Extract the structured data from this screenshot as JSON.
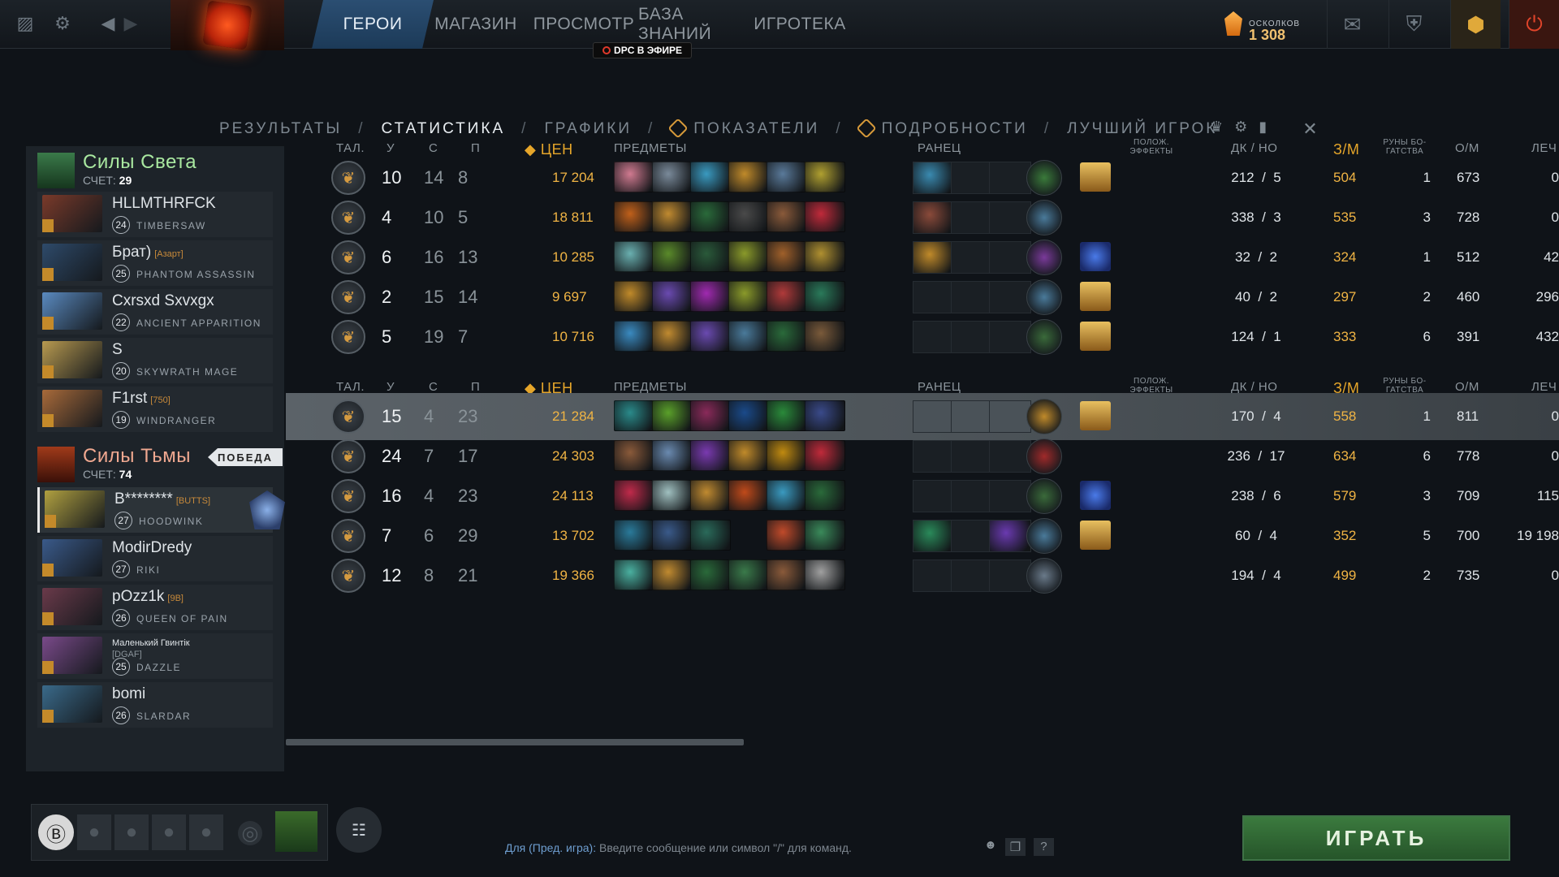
{
  "nav": {
    "tabs": [
      {
        "label": "ГЕРОИ",
        "active": true
      },
      {
        "label": "МАГАЗИН",
        "active": false
      },
      {
        "label": "ПРОСМОТР",
        "active": false
      },
      {
        "label": "БАЗА ЗНАНИЙ",
        "active": false
      },
      {
        "label": "ИГРОТЕКА",
        "active": false
      }
    ],
    "dpc_badge": "DPC В ЭФИРЕ",
    "shards": {
      "value": "1 308",
      "label": "ОСКОЛКОВ"
    }
  },
  "subtabs": [
    {
      "label": "РЕЗУЛЬТАТЫ",
      "active": false,
      "plus": false
    },
    {
      "label": "СТАТИСТИКА",
      "active": true,
      "plus": false
    },
    {
      "label": "ГРАФИКИ",
      "active": false,
      "plus": false
    },
    {
      "label": "ПОКАЗАТЕЛИ",
      "active": false,
      "plus": true
    },
    {
      "label": "ПОДРОБНОСТИ",
      "active": false,
      "plus": true
    },
    {
      "label": "ЛУЧШИЙ ИГРОК",
      "active": false,
      "plus": false
    }
  ],
  "headers": {
    "talent": "ТАЛ.",
    "kills": "У",
    "deaths": "С",
    "assists": "П",
    "networth": "ЦЕН",
    "items": "ПРЕДМЕТЫ",
    "backpack": "РАНЕЦ",
    "buffs": "ПОЛОЖ. ЭФФЕКТЫ",
    "lh_dn": "ДК / НО",
    "xpm": "З/М",
    "bounty": "РУНЫ БО-ГАТСТВА",
    "gpm": "О/М",
    "heal": "ЛЕЧ"
  },
  "radiant": {
    "name": "Силы Света",
    "score_label": "СЧЕТ:",
    "score": "29",
    "players": [
      {
        "name": "HLLMTHRFCK",
        "tag": "",
        "level": "24",
        "hero": "TIMBERSAW",
        "kills": "10",
        "deaths": "14",
        "assists": "8",
        "networth": "17 204",
        "lh": "212",
        "dn": "5",
        "xpm": "504",
        "bounty": "1",
        "gpm": "673",
        "heal": "0",
        "color": "#7a3a2a"
      },
      {
        "name": "Брат)",
        "tag": "[Азарт]",
        "level": "25",
        "hero": "PHANTOM ASSASSIN",
        "kills": "4",
        "deaths": "10",
        "assists": "5",
        "networth": "18 811",
        "lh": "338",
        "dn": "3",
        "xpm": "535",
        "bounty": "3",
        "gpm": "728",
        "heal": "0",
        "color": "#2e4a6a"
      },
      {
        "name": "Cxrsxd Sxvxgx",
        "tag": "",
        "level": "22",
        "hero": "ANCIENT APPARITION",
        "kills": "6",
        "deaths": "16",
        "assists": "13",
        "networth": "10 285",
        "lh": "32",
        "dn": "2",
        "xpm": "324",
        "bounty": "1",
        "gpm": "512",
        "heal": "42",
        "color": "#5a8ac0"
      },
      {
        "name": "S",
        "tag": "",
        "level": "20",
        "hero": "SKYWRATH MAGE",
        "kills": "2",
        "deaths": "15",
        "assists": "14",
        "networth": "9 697",
        "lh": "40",
        "dn": "2",
        "xpm": "297",
        "bounty": "2",
        "gpm": "460",
        "heal": "296",
        "color": "#b89a50"
      },
      {
        "name": "F1rst",
        "tag": "[750]",
        "level": "19",
        "hero": "WINDRANGER",
        "kills": "5",
        "deaths": "19",
        "assists": "7",
        "networth": "10 716",
        "lh": "124",
        "dn": "1",
        "xpm": "333",
        "bounty": "6",
        "gpm": "391",
        "heal": "432",
        "color": "#a86a3a"
      }
    ]
  },
  "dire": {
    "name": "Силы Тьмы",
    "victory": "ПОБЕДА",
    "score_label": "СЧЕТ:",
    "score": "74",
    "players": [
      {
        "name": "B********",
        "tag": "[BUTTS]",
        "level": "27",
        "hero": "HOODWINK",
        "kills": "15",
        "deaths": "4",
        "assists": "23",
        "networth": "21 284",
        "lh": "170",
        "dn": "4",
        "xpm": "558",
        "bounty": "1",
        "gpm": "811",
        "heal": "0",
        "color": "#b0a040"
      },
      {
        "name": "ModirDredy",
        "tag": "",
        "level": "27",
        "hero": "RIKI",
        "kills": "24",
        "deaths": "7",
        "assists": "17",
        "networth": "24 303",
        "lh": "236",
        "dn": "17",
        "xpm": "634",
        "bounty": "6",
        "gpm": "778",
        "heal": "0",
        "color": "#3a5a8a"
      },
      {
        "name": "pOzz1k",
        "tag": "[9B]",
        "level": "26",
        "hero": "QUEEN OF PAIN",
        "kills": "16",
        "deaths": "4",
        "assists": "23",
        "networth": "24 113",
        "lh": "238",
        "dn": "6",
        "xpm": "579",
        "bounty": "3",
        "gpm": "709",
        "heal": "115",
        "color": "#6a3a4a"
      },
      {
        "name": "Маленький Гвинтік",
        "tag": "",
        "tagline": "[DGAF]",
        "level": "25",
        "hero": "DAZZLE",
        "kills": "7",
        "deaths": "6",
        "assists": "29",
        "networth": "13 702",
        "lh": "60",
        "dn": "4",
        "xpm": "352",
        "bounty": "5",
        "gpm": "700",
        "heal": "19 198",
        "color": "#7a4a8a"
      },
      {
        "name": "bomi",
        "tag": "",
        "level": "26",
        "hero": "SLARDAR",
        "kills": "12",
        "deaths": "8",
        "assists": "21",
        "networth": "19 366",
        "lh": "194",
        "dn": "4",
        "xpm": "499",
        "bounty": "2",
        "gpm": "735",
        "heal": "0",
        "color": "#3a6a8a"
      }
    ]
  },
  "chat": {
    "channel": "Для (Пред. игра):",
    "placeholder": "Введите сообщение или символ \"/\" для команд."
  },
  "play_button": "ИГРАТЬ"
}
